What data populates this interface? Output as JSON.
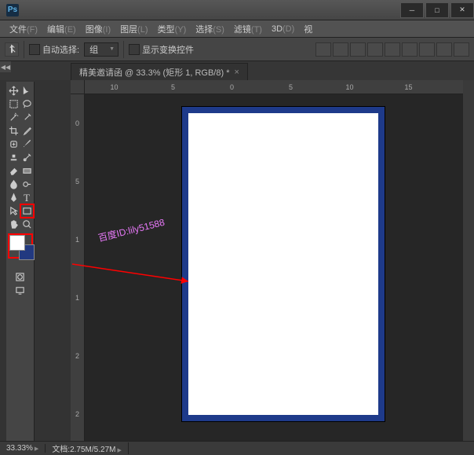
{
  "app": {
    "logo": "Ps"
  },
  "menu": [
    {
      "l": "文件",
      "k": "(F)"
    },
    {
      "l": "编辑",
      "k": "(E)"
    },
    {
      "l": "图像",
      "k": "(I)"
    },
    {
      "l": "图层",
      "k": "(L)"
    },
    {
      "l": "类型",
      "k": "(Y)"
    },
    {
      "l": "选择",
      "k": "(S)"
    },
    {
      "l": "滤镜",
      "k": "(T)"
    },
    {
      "l": "3D",
      "k": "(D)"
    },
    {
      "l": "视",
      "k": ""
    }
  ],
  "opt": {
    "autoSelect": "自动选择:",
    "group": "组",
    "showTransform": "显示变换控件"
  },
  "tab": {
    "title": "精美邀请函 @ 33.3% (矩形 1, RGB/8) *",
    "close": "×"
  },
  "rulerH": [
    "10",
    "5",
    "0",
    "5",
    "10",
    "15"
  ],
  "rulerV": [
    "0",
    "5",
    "1",
    "1",
    "2",
    "2"
  ],
  "annotation": {
    "text": "百度ID:lily51588"
  },
  "colors": {
    "fg": "#ffffff",
    "bg": "#223980",
    "pageBorder": "#1e3a8a"
  },
  "zoom": "33.33%",
  "docinfo": "文档:2.75M/5.27M",
  "collapse": "◀◀"
}
